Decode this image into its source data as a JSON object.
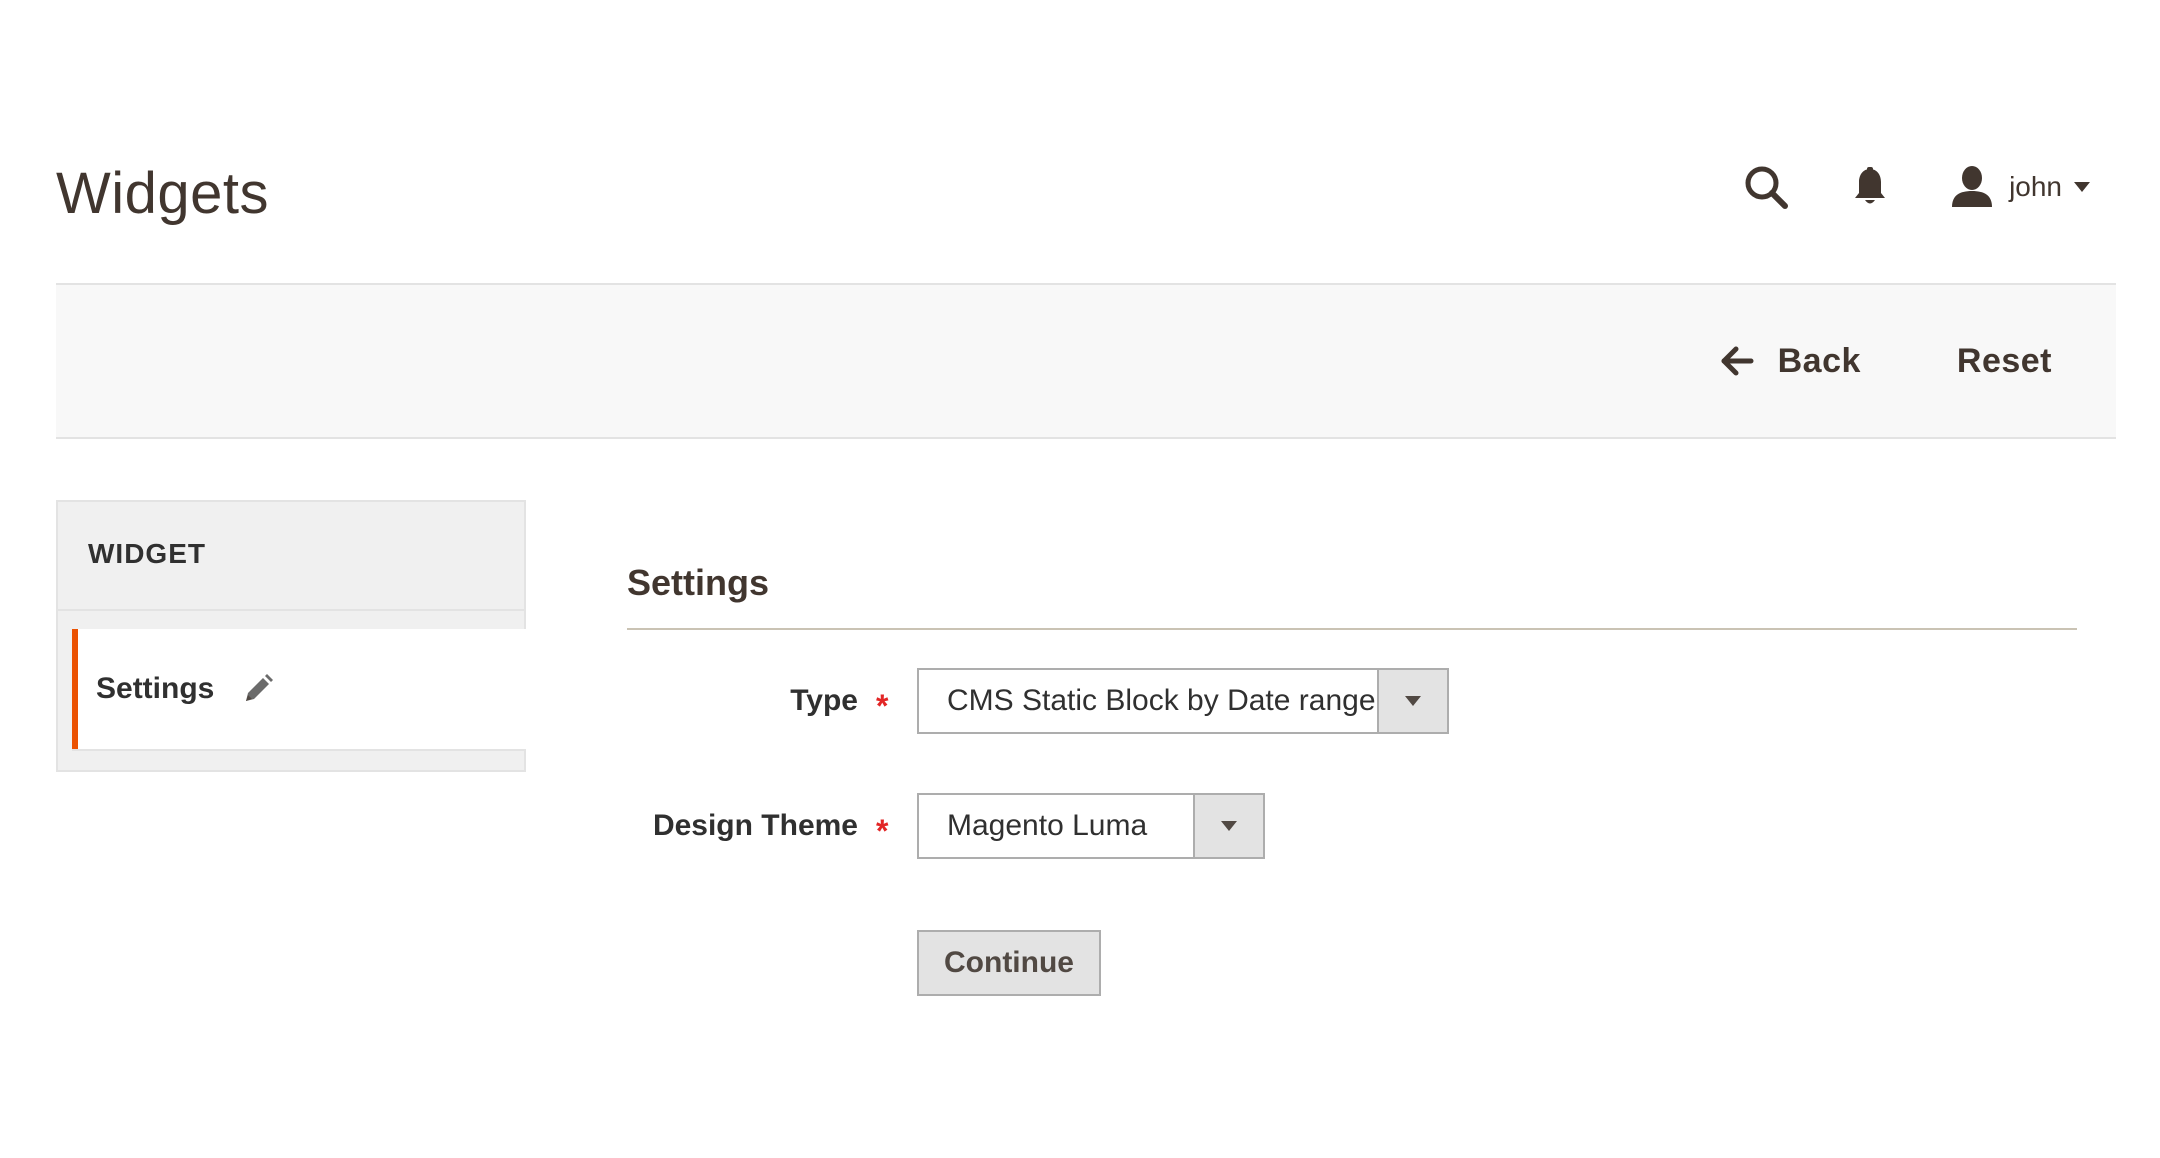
{
  "header": {
    "title": "Widgets",
    "user_name": "john",
    "icons": [
      "search-icon",
      "bell-icon",
      "user-icon",
      "chevron-down-icon"
    ]
  },
  "actions": {
    "back_label": "Back",
    "reset_label": "Reset"
  },
  "tabs": {
    "title": "WIDGET",
    "items": [
      {
        "label": "Settings",
        "active": true,
        "icon": "pencil-icon"
      }
    ],
    "accent_color": "#eb5202"
  },
  "settings": {
    "title": "Settings",
    "fields": [
      {
        "label": "Type",
        "required": true,
        "value": "CMS Static Block by Date range"
      },
      {
        "label": "Design Theme",
        "required": true,
        "value": "Magento Luma"
      }
    ],
    "required_marker": "*",
    "continue_label": "Continue"
  }
}
